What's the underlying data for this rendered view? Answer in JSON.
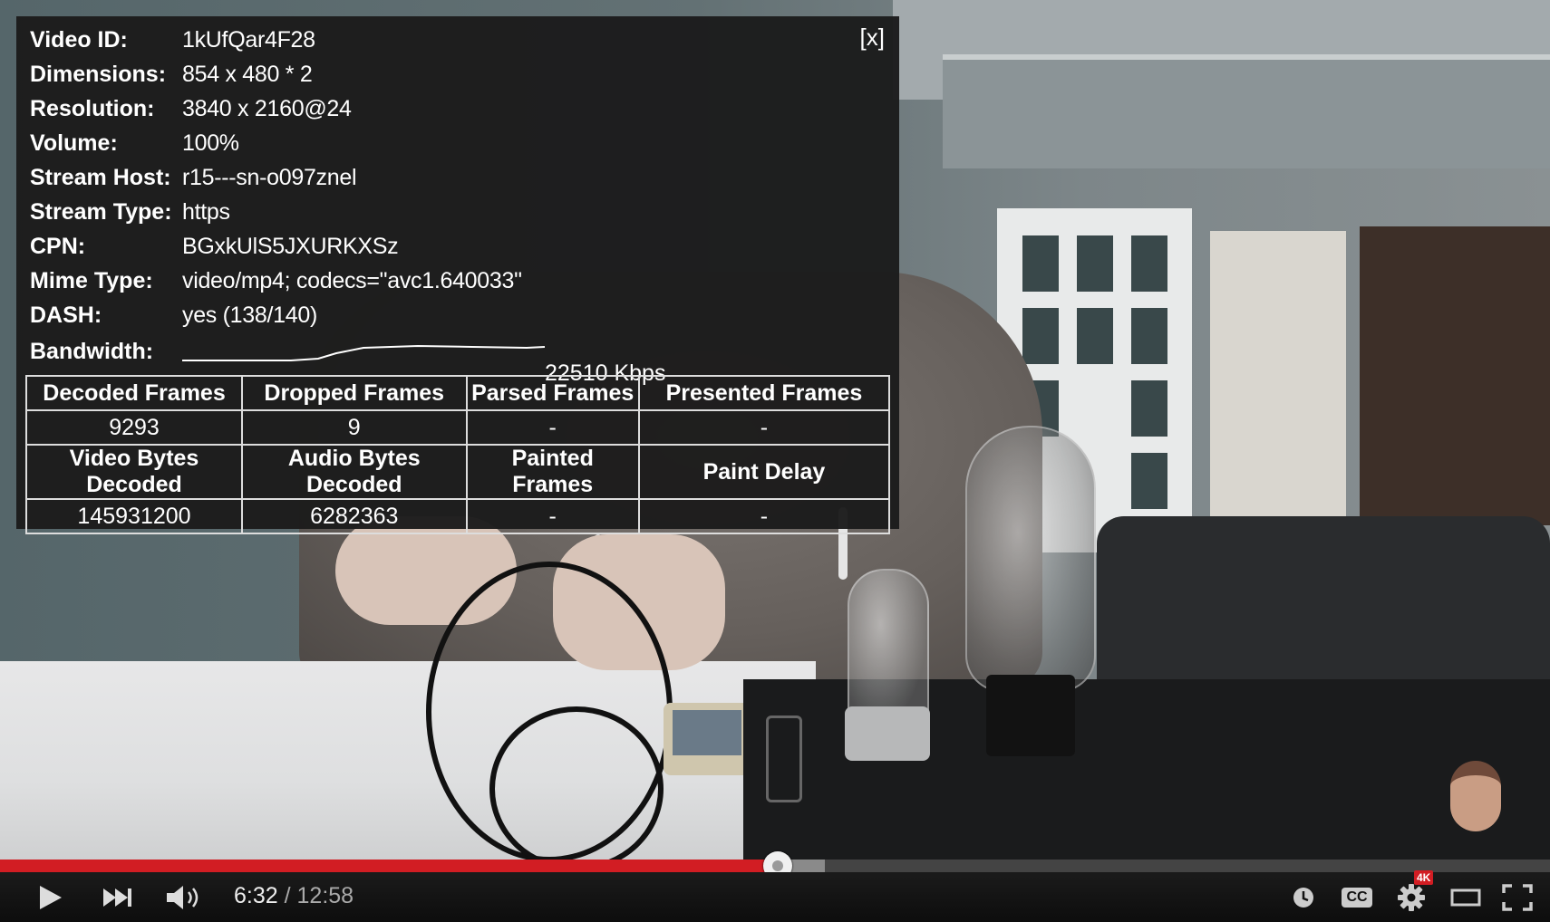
{
  "stats_panel": {
    "close_label": "[x]",
    "rows": [
      {
        "label": "Video ID:",
        "value": "1kUfQar4F28"
      },
      {
        "label": "Dimensions:",
        "value": "854 x 480 * 2"
      },
      {
        "label": "Resolution:",
        "value": "3840 x 2160@24"
      },
      {
        "label": "Volume:",
        "value": "100%"
      },
      {
        "label": "Stream Host:",
        "value": "r15---sn-o097znel"
      },
      {
        "label": "Stream Type:",
        "value": "https"
      },
      {
        "label": "CPN:",
        "value": "BGxkUlS5JXURKXSz"
      },
      {
        "label": "Mime Type:",
        "value": "video/mp4; codecs=\"avc1.640033\""
      },
      {
        "label": "DASH:",
        "value": "yes (138/140)"
      }
    ],
    "bandwidth": {
      "label": "Bandwidth:",
      "value": "22510 Kbps"
    },
    "frames_table": [
      [
        "Decoded Frames",
        "Dropped Frames",
        "Parsed Frames",
        "Presented Frames"
      ],
      [
        "9293",
        "9",
        "-",
        "-"
      ],
      [
        "Video Bytes Decoded",
        "Audio Bytes Decoded",
        "Painted Frames",
        "Paint Delay"
      ],
      [
        "145931200",
        "6282363",
        "-",
        "-"
      ]
    ]
  },
  "player": {
    "current_time": "6:32",
    "separator": " / ",
    "duration": "12:58",
    "progress_fraction": 0.502,
    "buffered_fraction": 0.532,
    "quality_badge": "4K",
    "icons": [
      "play-icon",
      "next-icon",
      "volume-icon",
      "watch-later-icon",
      "captions-icon",
      "settings-icon",
      "theater-mode-icon",
      "fullscreen-icon"
    ],
    "captions_label": "CC",
    "accent_color": "#d21d23"
  }
}
